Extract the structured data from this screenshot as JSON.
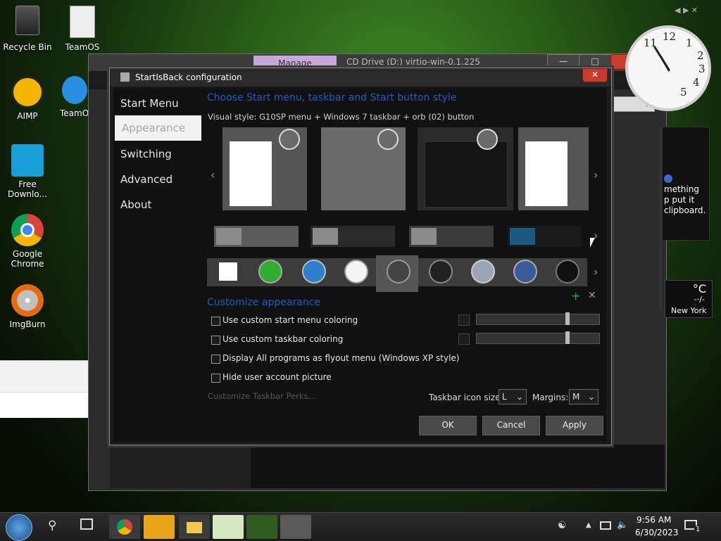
{
  "desktop": {
    "icons": [
      {
        "label": "Recycle Bin"
      },
      {
        "label": "TeamOS"
      },
      {
        "label": "AIMP"
      },
      {
        "label": "TeamO"
      },
      {
        "label": "Free Downlo..."
      },
      {
        "label": "Google Chrome"
      },
      {
        "label": "ImgBurn"
      }
    ]
  },
  "explorer": {
    "manage_tab": "Manage",
    "title": "CD Drive (D:) virtio-win-0.1.225",
    "info_text": "mething\np put it\nclipboard."
  },
  "weather": {
    "temp": "°C",
    "dashes": "-·/-",
    "city": "New York"
  },
  "dialog": {
    "title": "StartIsBack configuration",
    "nav": [
      "Start Menu",
      "Appearance",
      "Switching",
      "Advanced",
      "About"
    ],
    "section1_title": "Choose Start menu, taskbar and Start button style",
    "visual_style": "Visual style:  G10SP menu + Windows 7 taskbar + orb (02) button",
    "section2_title": "Customize appearance",
    "options": [
      "Use custom start menu coloring",
      "Use custom taskbar coloring",
      "Display All programs as flyout menu (Windows XP style)",
      "Hide user account picture"
    ],
    "customize_link": "Customize Taskbar Perks...",
    "taskbar_icon_size_label": "Taskbar icon size:",
    "taskbar_icon_size_value": "L",
    "margins_label": "Margins:",
    "margins_value": "M",
    "ok": "OK",
    "cancel": "Cancel",
    "apply": "Apply"
  },
  "taskbar": {
    "time": "9:56 AM",
    "date": "6/30/2023",
    "notif_count": "1"
  },
  "colors": {
    "accent": "#1d5dc2",
    "close": "#c83c2c"
  }
}
